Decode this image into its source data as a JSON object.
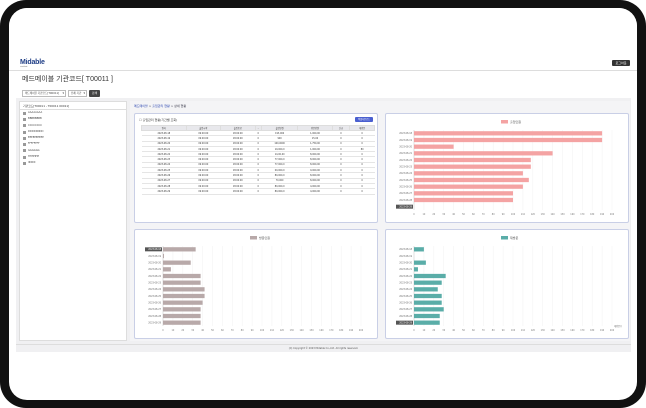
{
  "app": {
    "logo_text": "Midable",
    "logo_sub": "coordinate",
    "logout_label": "로그아웃",
    "page_title": "메드메이블 기관코드[ T00011 ]"
  },
  "filters": {
    "org_select": "메드메이블 기관코드[T00011]",
    "period_select": "전체 기간",
    "search_label": "검색"
  },
  "sidebar": {
    "header": "기관코드[T00011 - T00011 00011]",
    "items": [
      {
        "label": "AAAAAAAA"
      },
      {
        "label": "BBBBBBBB"
      },
      {
        "label": "CCCCCCCC"
      },
      {
        "label": "DDDDDDDD"
      },
      {
        "label": "EEEEEEEEEE"
      },
      {
        "label": "FFFFFFFF"
      },
      {
        "label": "GGGGGG"
      },
      {
        "label": "HHHHHH"
      },
      {
        "label": "IIIIIIIIII"
      }
    ]
  },
  "breadcrumb": {
    "part1": "메드메이블",
    "part2": "출입관리 현황",
    "part3": "상세 현황"
  },
  "table": {
    "title": "출입관리 현황(기간별 조회)",
    "button": "엑셀다운로드",
    "headers": [
      "일자",
      "출입시작",
      "출입종료",
      "-",
      "출입인원",
      "방문인원",
      "신규",
      "재방문"
    ],
    "rows": [
      [
        "2023-08-18",
        "09:00:00",
        "18:00:00",
        "0",
        "193,000",
        "1,000,00",
        "0",
        "0"
      ],
      [
        "2023-08-19",
        "09:00:00",
        "18:00:00",
        "0",
        "900",
        "15,00",
        "0",
        "0"
      ],
      [
        "2023-08-20",
        "09:00:00",
        "18:00:00",
        "0",
        "100,0000",
        "1,750,00",
        "0",
        "0"
      ],
      [
        "2023-08-21",
        "09:00:00",
        "18:00:00",
        "0",
        "19,000,0",
        "1,000,00",
        "0",
        "80"
      ],
      [
        "2023-08-22",
        "09:00:00",
        "18:00:00",
        "0",
        "14,00,00",
        "8,000,00",
        "0",
        "0"
      ],
      [
        "2023-08-23",
        "09:00:00",
        "18:00:00",
        "0",
        "77,000,0",
        "8,000,00",
        "0",
        "0"
      ],
      [
        "2023-08-24",
        "09:00:00",
        "18:00:00",
        "0",
        "77,000,0",
        "8,000,00",
        "0",
        "0"
      ],
      [
        "2023-08-25",
        "09:00:00",
        "18:00:00",
        "0",
        "00,000,0",
        "9,000,00",
        "0",
        "0"
      ],
      [
        "2023-08-26",
        "09:00:00",
        "18:00:00",
        "0",
        "80,000,0",
        "8,000,00",
        "0",
        "0"
      ],
      [
        "2023-08-27",
        "09:00:00",
        "18:00:00",
        "0",
        "70,000",
        "8,000,00",
        "0",
        "0"
      ],
      [
        "2023-08-28",
        "09:00:00",
        "18:00:00",
        "0",
        "80,000,0",
        "4,000,00",
        "0",
        "0"
      ],
      [
        "2023-08-29",
        "09:00:00",
        "18:00:00",
        "0",
        "80,000,0",
        "4,000,00",
        "0",
        "0"
      ]
    ]
  },
  "chart_data": [
    {
      "type": "bar",
      "orientation": "horizontal",
      "legend": "출입인원",
      "color": "#f4a3a3",
      "categories": [
        "2023-08-18",
        "2023-08-19",
        "2023-08-20",
        "2023-08-21",
        "2023-08-22",
        "2023-08-23",
        "2023-08-24",
        "2023-08-25",
        "2023-08-26",
        "2023-08-27",
        "2023-08-28",
        "2023-08-29"
      ],
      "values": [
        190,
        190,
        40,
        140,
        118,
        118,
        110,
        116,
        110,
        100,
        100,
        0
      ],
      "xlim": [
        0,
        200
      ],
      "xticks": [
        "0",
        "10",
        "20",
        "30",
        "40",
        "50",
        "60",
        "70",
        "80",
        "90",
        "100",
        "110",
        "120",
        "130",
        "140",
        "150",
        "160",
        "170",
        "180",
        "190",
        "200"
      ],
      "highlight_last": true
    },
    {
      "type": "bar",
      "orientation": "horizontal",
      "legend": "방문인원",
      "color": "#b8a9a9",
      "categories": [
        "2023-08-18",
        "2023-08-19",
        "2023-08-20",
        "2023-08-21",
        "2023-08-22",
        "2023-08-23",
        "2023-08-24",
        "2023-08-25",
        "2023-08-26",
        "2023-08-27",
        "2023-08-28",
        "2023-08-29"
      ],
      "values": [
        33,
        1,
        28,
        8,
        38,
        38,
        42,
        42,
        40,
        38,
        38,
        38
      ],
      "xlim": [
        0,
        200
      ],
      "xticks": [
        "0",
        "10",
        "20",
        "30",
        "40",
        "50",
        "60",
        "70",
        "80",
        "90",
        "100",
        "110",
        "120",
        "130",
        "140",
        "150",
        "160",
        "170",
        "180",
        "190",
        "200"
      ],
      "highlight_first": true
    },
    {
      "type": "bar",
      "orientation": "horizontal",
      "legend": "재방문",
      "color": "#5aada8",
      "categories": [
        "2023-08-18",
        "2023-08-19",
        "2023-08-20",
        "2023-08-21",
        "2023-08-22",
        "2023-08-23",
        "2023-08-24",
        "2023-08-25",
        "2023-08-26",
        "2023-08-27",
        "2023-08-28",
        "2023-08-29"
      ],
      "values": [
        10,
        0,
        12,
        4,
        32,
        28,
        24,
        28,
        28,
        30,
        26,
        26
      ],
      "xlim": [
        0,
        200
      ],
      "xticks": [
        "0",
        "10",
        "20",
        "30",
        "40",
        "50",
        "60",
        "70",
        "80",
        "90",
        "100",
        "110",
        "120",
        "130",
        "140",
        "150",
        "160",
        "170",
        "180",
        "190",
        "200"
      ],
      "highlight_last": true,
      "axis_note": "재방문수"
    }
  ],
  "footer": "(C) Copyright © 2023 Midable Co.,Ltd. All rights reserved."
}
